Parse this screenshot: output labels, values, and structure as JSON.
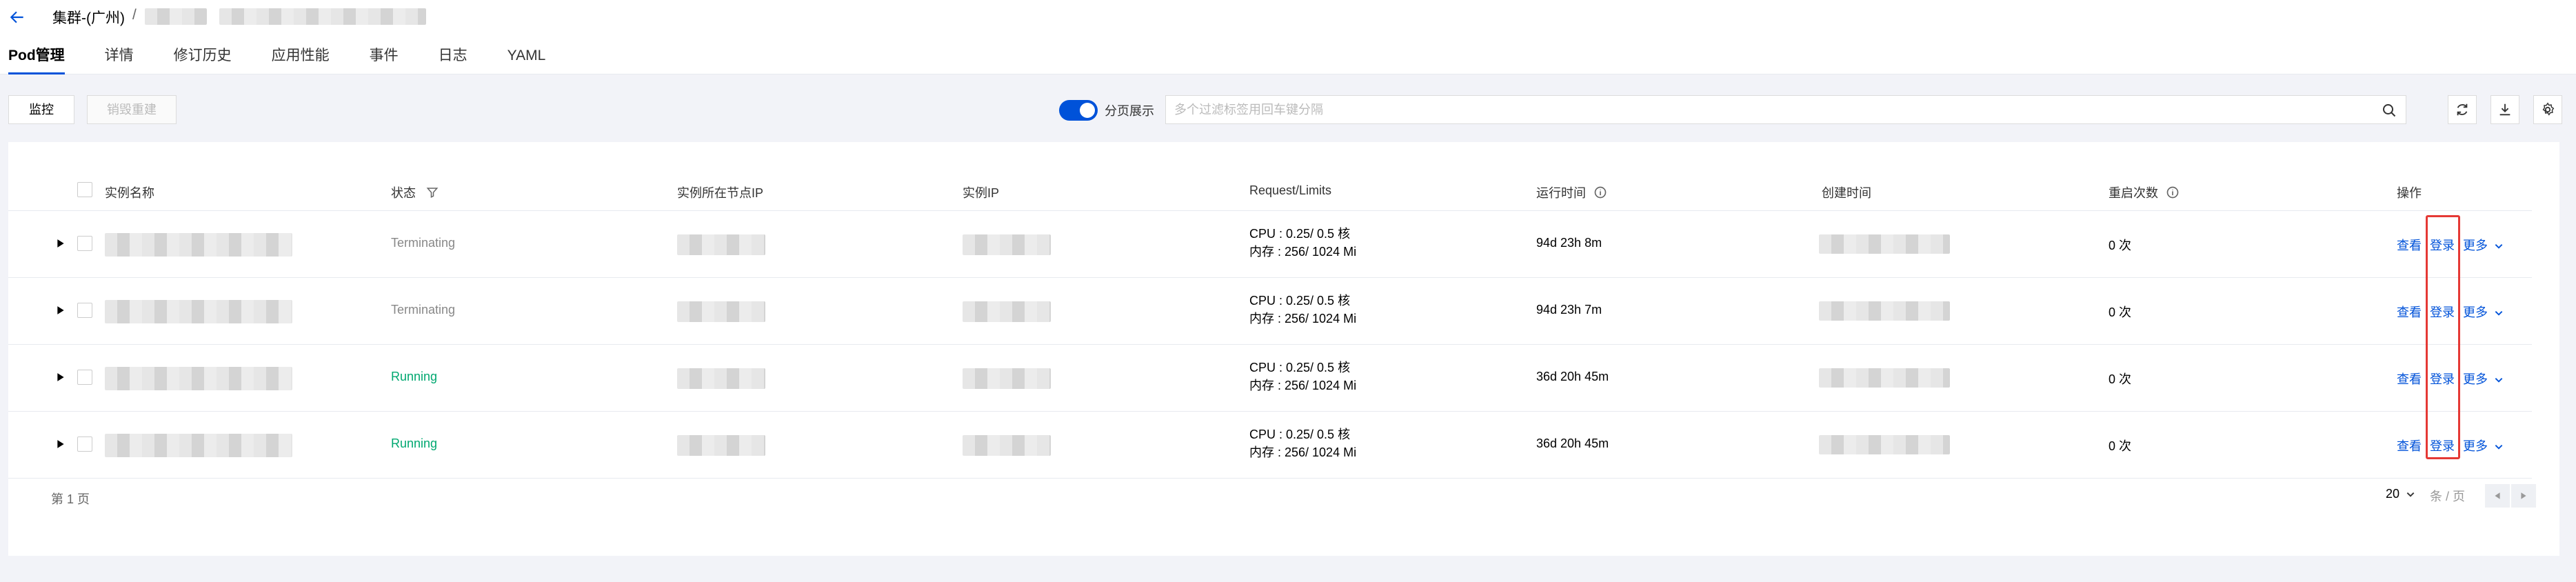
{
  "header": {
    "title": "集群-(广州)",
    "separator": "/",
    "tabs": [
      {
        "label": "Pod管理",
        "active": true
      },
      {
        "label": "详情"
      },
      {
        "label": "修订历史"
      },
      {
        "label": "应用性能"
      },
      {
        "label": "事件"
      },
      {
        "label": "日志"
      },
      {
        "label": "YAML"
      }
    ]
  },
  "toolbar": {
    "monitor_label": "监控",
    "destroy_label": "销毁重建",
    "pagination_toggle_label": "分页展示",
    "pagination_toggle_on": true,
    "search_placeholder": "多个过滤标签用回车键分隔"
  },
  "table": {
    "columns": {
      "name": "实例名称",
      "status": "状态",
      "node_ip": "实例所在节点IP",
      "instance_ip": "实例IP",
      "request_limits": "Request/Limits",
      "runtime": "运行时间",
      "created": "创建时间",
      "restarts": "重启次数",
      "actions": "操作"
    },
    "rows": [
      {
        "status": "Terminating",
        "cpu": "CPU : 0.25/ 0.5 核",
        "mem": "内存 : 256/ 1024 Mi",
        "runtime": "94d 23h 8m",
        "restarts": "0 次",
        "view": "查看",
        "login": "登录",
        "more": "更多"
      },
      {
        "status": "Terminating",
        "cpu": "CPU : 0.25/ 0.5 核",
        "mem": "内存 : 256/ 1024 Mi",
        "runtime": "94d 23h 7m",
        "restarts": "0 次",
        "view": "查看",
        "login": "登录",
        "more": "更多"
      },
      {
        "status": "Running",
        "cpu": "CPU : 0.25/ 0.5 核",
        "mem": "内存 : 256/ 1024 Mi",
        "runtime": "36d 20h 45m",
        "restarts": "0 次",
        "view": "查看",
        "login": "登录",
        "more": "更多"
      },
      {
        "status": "Running",
        "cpu": "CPU : 0.25/ 0.5 核",
        "mem": "内存 : 256/ 1024 Mi",
        "runtime": "36d 20h 45m",
        "restarts": "0 次",
        "view": "查看",
        "login": "登录",
        "more": "更多"
      }
    ]
  },
  "footer": {
    "page_text": "第 1 页",
    "page_size": "20",
    "page_unit": "条 / 页"
  },
  "colors": {
    "primary": "#0052d9",
    "running": "#00a870",
    "terminating": "#888888",
    "highlight": "#e53935"
  }
}
